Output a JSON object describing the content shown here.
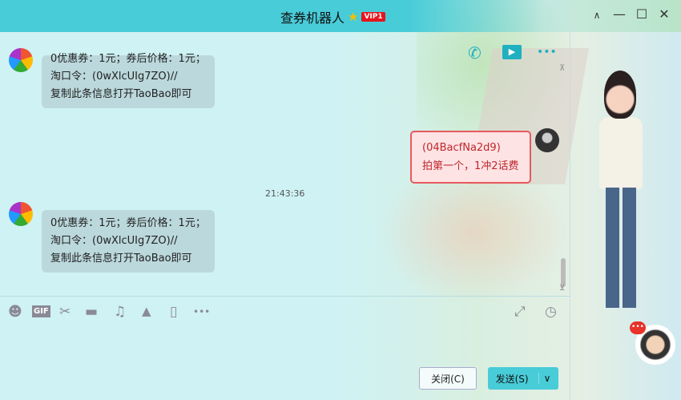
{
  "window": {
    "title": "查券机器人",
    "vip": "VIP1",
    "min": "—",
    "max": "☐",
    "close": "✕",
    "collapse": "∧"
  },
  "header_icons": {
    "call": "✆",
    "video": "▶",
    "more": "•••"
  },
  "messages": [
    {
      "lines": [
        "0优惠券：1元；券后价格：1元；",
        "淘口令：(0wXlcUIg7ZO)//",
        "复制此条信息打开TaoBao即可"
      ]
    },
    {
      "time": "21:43:36"
    },
    {
      "lines": [
        "0优惠券：1元；券后价格：1元；",
        "淘口令：(0wXlcUIg7ZO)//",
        "复制此条信息打开TaoBao即可"
      ]
    }
  ],
  "my_message": {
    "lines": [
      "(04BacfNa2d9)",
      "拍第一个，1冲2话费"
    ]
  },
  "toolbar": {
    "emoji": "☻",
    "gif": "GIF",
    "scissors": "✂",
    "folder": "▬",
    "music": "♫",
    "image": "▲",
    "shake": "▯",
    "more": "•••",
    "expand": "⤢",
    "history": "◷"
  },
  "buttons": {
    "close": "关闭(C)",
    "send": "发送(S)",
    "send_arrow": "∨"
  },
  "scroll": {
    "up": "⊼",
    "down": "⊻"
  },
  "robot_badge": "•••"
}
